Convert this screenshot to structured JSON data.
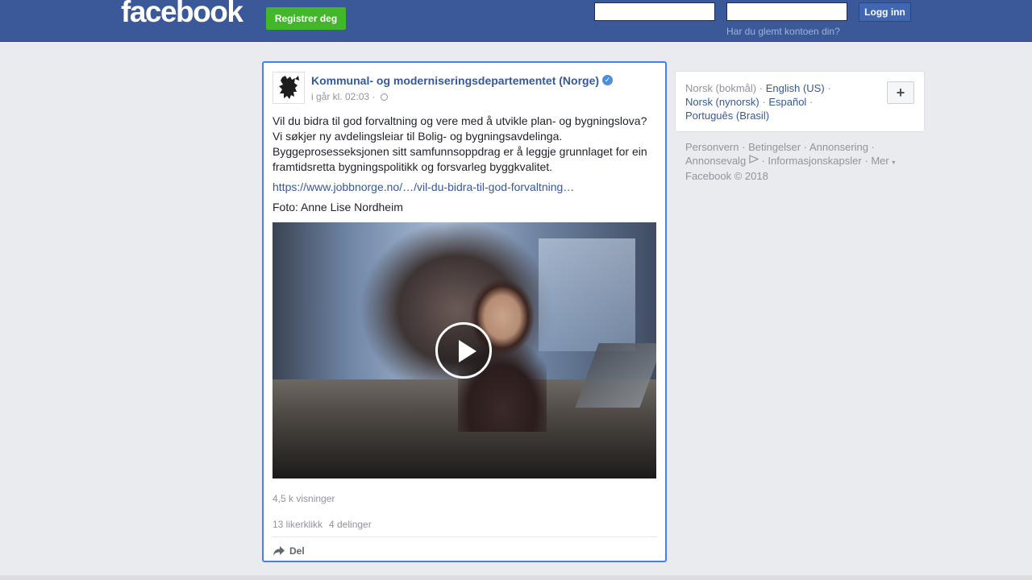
{
  "header": {
    "logo": "facebook",
    "register_label": "Registrer deg",
    "email_value": "",
    "password_value": "",
    "login_label": "Logg inn",
    "forgot_label": "Har du glemt kontoen din?"
  },
  "post": {
    "page_name": "Kommunal- og moderniseringsdepartementet (Norge)",
    "timestamp": "i går kl. 02:03 ·",
    "text_lines": [
      "Vil du bidra til god forvaltning og vere med å utvikle plan- og bygningslova?",
      "Vi søkjer ny avdelingsleiar til Bolig- og bygningsavdelinga.",
      "Byggeprosesseksjonen sitt samfunnsoppdrag er å leggje grunnlaget for ein framtidsretta bygningspolitikk og forsvarleg byggkvalitet."
    ],
    "link": "https://www.jobbnorge.no/…/vil-du-bidra-til-god-forvaltning…",
    "photo_credit": "Foto: Anne Lise Nordheim",
    "views": "4,5 k visninger",
    "likes": "13 likerklikk",
    "shares": "4 delinger",
    "share_label": "Del"
  },
  "languages": {
    "current": "Norsk (bokmål)",
    "sep": "·",
    "items": [
      "English (US)",
      "Norsk (nynorsk)",
      "Español",
      "Português (Brasil)"
    ],
    "plus_label": "+"
  },
  "footer": {
    "links": [
      "Personvern",
      "Betingelser",
      "Annonsering",
      "Annonsevalg",
      "Informasjonskapsler",
      "Mer"
    ],
    "sep": "·",
    "copyright": "Facebook © 2018"
  },
  "colors": {
    "header_bg": "#3b5998",
    "register_green": "#42b72a",
    "link_blue": "#365899",
    "focus_border": "#4080ff",
    "verified_blue": "#4a90e2"
  }
}
